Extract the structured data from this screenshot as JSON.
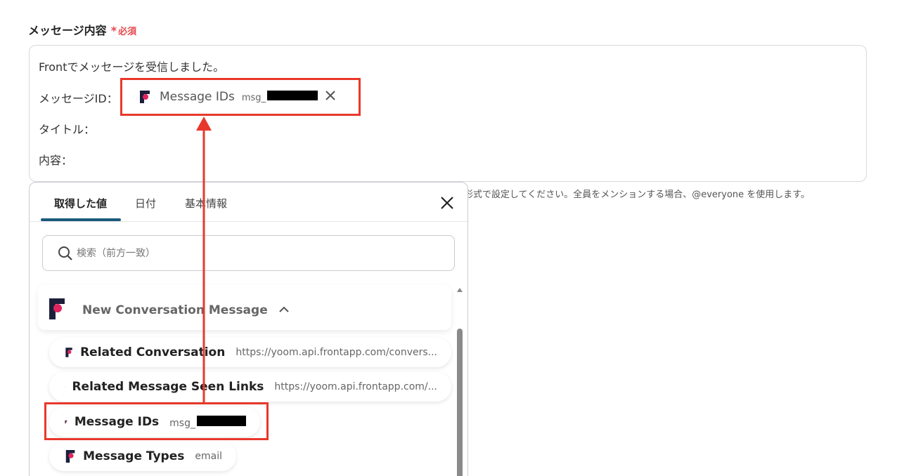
{
  "field": {
    "label": "メッセージ内容",
    "required_star": "*",
    "required_text": "必須"
  },
  "editor": {
    "line1": "Frontでメッセージを受信しました。",
    "line2": "メッセージID：",
    "line3": "タイトル：",
    "line4": "内容："
  },
  "chip": {
    "name": "Message IDs",
    "value_prefix": "msg_"
  },
  "hint": "形式で設定してください。全員をメンションする場合、@everyone を使用します。",
  "picker": {
    "tabs": [
      {
        "label": "取得した値"
      },
      {
        "label": "日付"
      },
      {
        "label": "基本情報"
      }
    ],
    "search_placeholder": "検索（前方一致）",
    "group_title": "New Conversation Message",
    "items": [
      {
        "name": "Related Conversation",
        "value": "https://yoom.api.frontapp.com/convers..."
      },
      {
        "name": "Related Message Seen Links",
        "value": "https://yoom.api.frontapp.com/..."
      },
      {
        "name": "Message IDs",
        "value": "msg_"
      },
      {
        "name": "Message Types",
        "value": "email"
      }
    ]
  },
  "colors": {
    "highlight": "#e8382b",
    "required": "#e5484d",
    "tab_active": "#1a5a7a",
    "front_logo_dark": "#1d1f3a",
    "front_logo_pink": "#e0245e"
  }
}
